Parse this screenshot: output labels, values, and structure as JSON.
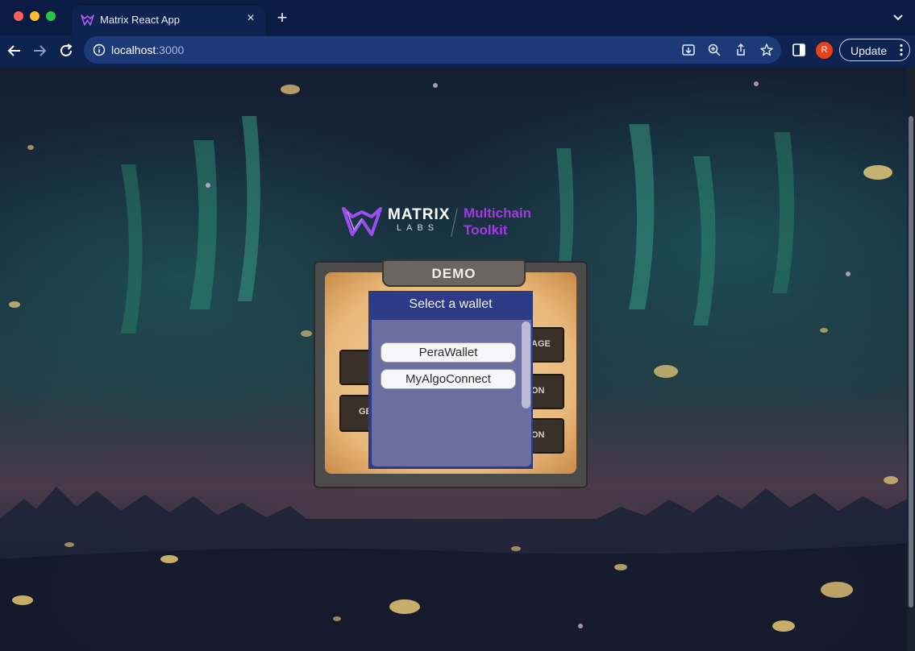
{
  "browser": {
    "tab_title": "Matrix React App",
    "tab_close": "×",
    "new_tab": "+",
    "url_host": "localhost",
    "url_port": ":3000",
    "avatar_initial": "R",
    "update_label": "Update"
  },
  "page": {
    "logo": {
      "word": "MATRIX",
      "sub": "LABS",
      "tagline_line1": "Multichain",
      "tagline_line2": "Toolkit",
      "accent_color": "#a637e8"
    },
    "panel": {
      "header": "DEMO",
      "partial_buttons": [
        "GE",
        "AGE",
        "ON",
        "ON"
      ]
    },
    "wallet_modal": {
      "title": "Select a wallet",
      "options": [
        "PeraWallet",
        "MyAlgoConnect"
      ]
    }
  }
}
